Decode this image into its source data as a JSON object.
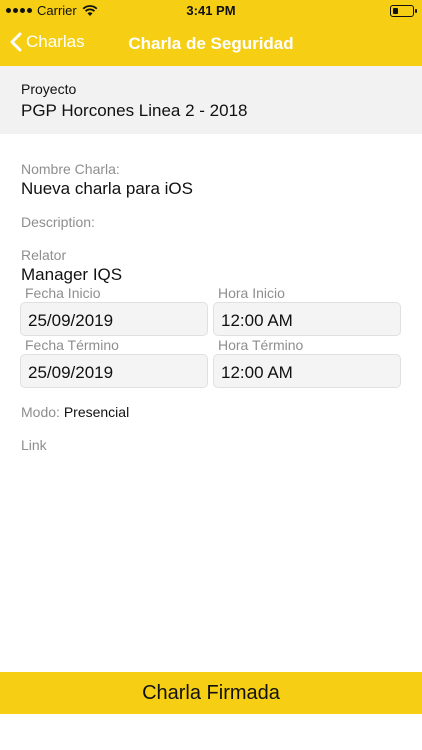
{
  "status_bar": {
    "carrier": "Carrier",
    "time": "3:41 PM",
    "battery_level": 0.3,
    "icons": [
      "signal-dots-icon",
      "wifi-icon",
      "battery-icon"
    ]
  },
  "nav": {
    "back_label": "Charlas",
    "title": "Charla de Seguridad",
    "back_icon": "chevron-left-icon"
  },
  "project": {
    "label": "Proyecto",
    "value": "PGP Horcones Linea 2 - 2018"
  },
  "form": {
    "nombre_label": "Nombre Charla:",
    "nombre_value": "Nueva charla para iOS",
    "description_label": "Description:",
    "relator_label": "Relator",
    "relator_value": "Manager IQS",
    "fecha_inicio_label": "Fecha Inicio",
    "fecha_inicio_value": "25/09/2019",
    "hora_inicio_label": "Hora Inicio",
    "hora_inicio_value": "12:00 AM",
    "fecha_termino_label": "Fecha Término",
    "fecha_termino_value": "25/09/2019",
    "hora_termino_label": "Hora Término",
    "hora_termino_value": "12:00 AM",
    "modo_label": "Modo:",
    "modo_value": "Presencial",
    "link_label": "Link"
  },
  "footer": {
    "button_label": "Charla Firmada"
  },
  "colors": {
    "accent": "#f6cf14",
    "label_gray": "#8e8e8e",
    "section_bg": "#f2f2f2"
  }
}
